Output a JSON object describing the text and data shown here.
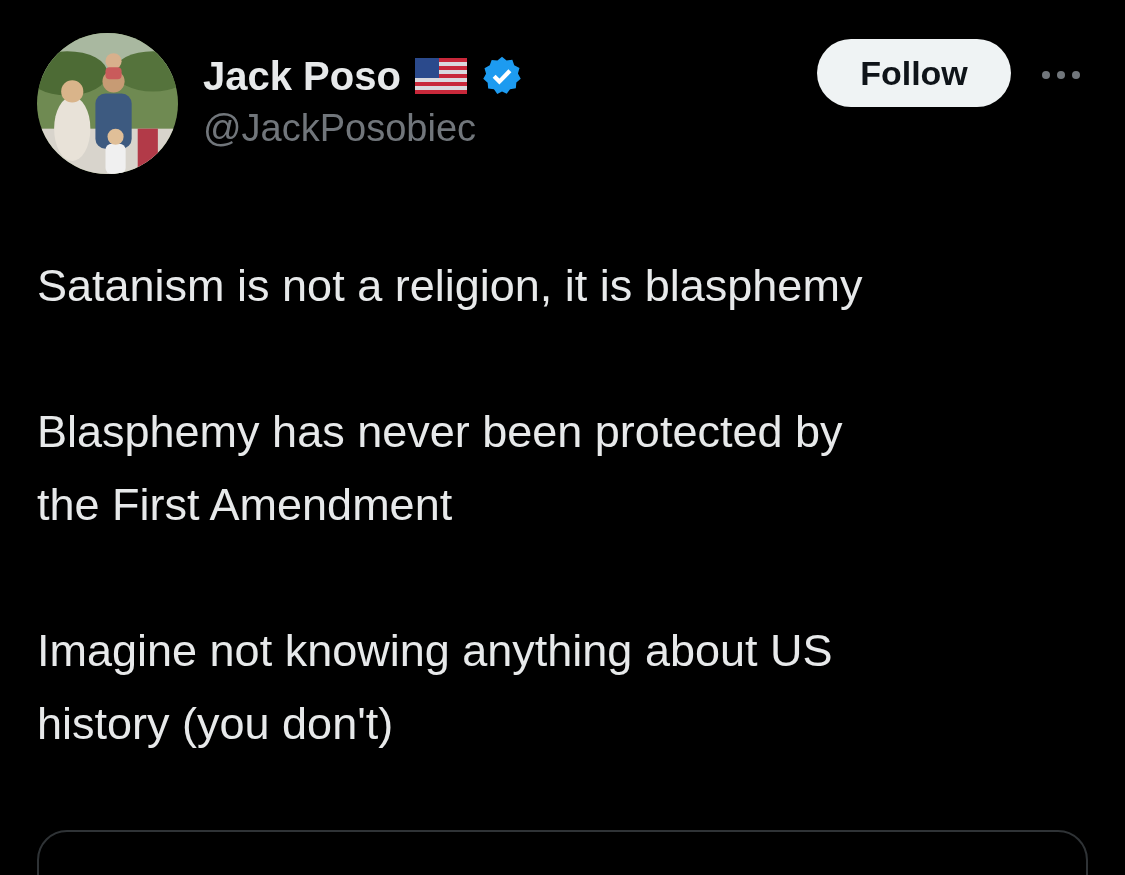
{
  "author": {
    "name": "Jack Poso",
    "handle": "@JackPosobiec",
    "verified": true
  },
  "follow_button": {
    "label": "Follow"
  },
  "paragraphs": [
    [
      "Satanism is not a religion, it is blasphemy"
    ],
    [
      "Blasphemy has never been protected by",
      "the First Amendment"
    ],
    [
      "Imagine not knowing anything about US",
      "history (you don't)"
    ]
  ]
}
